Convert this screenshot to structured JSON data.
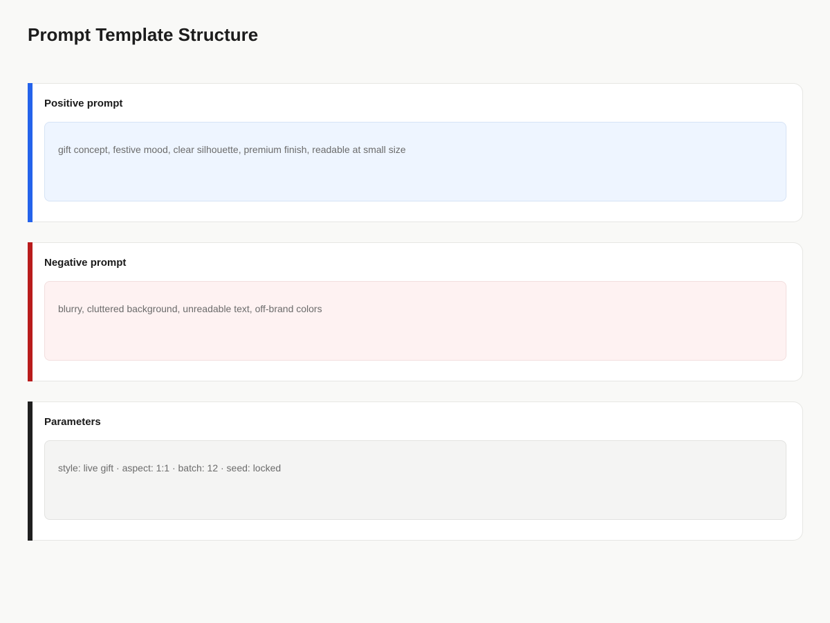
{
  "page": {
    "title": "Prompt Template Structure"
  },
  "sections": [
    {
      "id": "positive",
      "title": "Positive prompt",
      "text": "gift concept, festive mood, clear silhouette, premium finish, readable at small size",
      "accent_color": "#2563eb",
      "box_background": "#eef5ff",
      "box_border": "#d6e3f5"
    },
    {
      "id": "negative",
      "title": "Negative prompt",
      "text": "blurry, cluttered background, unreadable text, off-brand colors",
      "accent_color": "#b91c1c",
      "box_background": "#fef2f2",
      "box_border": "#f2dede"
    },
    {
      "id": "params",
      "title": "Parameters",
      "text": "style: live gift · aspect: 1:1 · batch: 12 · seed: locked",
      "accent_color": "#1f1f1f",
      "box_background": "#f4f4f3",
      "box_border": "#e2e2e0"
    }
  ]
}
